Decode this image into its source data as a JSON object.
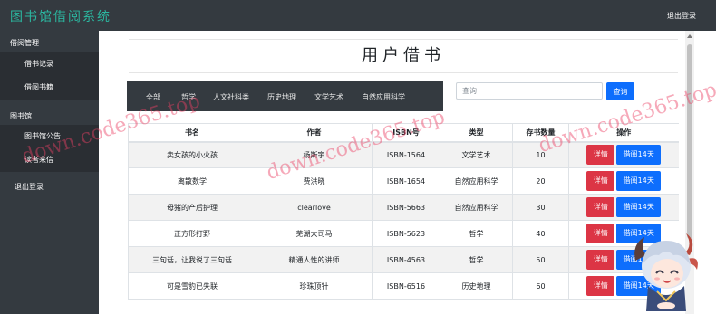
{
  "app": {
    "title": "图书馆借阅系统",
    "logout_label": "退出登录"
  },
  "sidebar": {
    "sections": [
      {
        "title": "借阅管理",
        "items": [
          "借书记录",
          "借阅书籍"
        ]
      },
      {
        "title": "图书馆",
        "items": [
          "图书馆公告",
          "读者来信"
        ]
      }
    ],
    "last_item": "退出登录"
  },
  "page": {
    "title": "用户借书"
  },
  "categories": [
    "全部",
    "哲学",
    "人文社科类",
    "历史地理",
    "文学艺术",
    "自然应用科学"
  ],
  "search": {
    "placeholder": "查询",
    "button_label": "查询"
  },
  "table": {
    "headers": [
      "书名",
      "作者",
      "ISBN号",
      "类型",
      "存书数量",
      "操作"
    ],
    "rows": [
      {
        "title": "卖女孩的小火孩",
        "author": "杨斯宇",
        "isbn": "ISBN-1564",
        "type": "文学艺术",
        "stock": "10"
      },
      {
        "title": "离散数学",
        "author": "费洪晓",
        "isbn": "ISBN-1654",
        "type": "自然应用科学",
        "stock": "20"
      },
      {
        "title": "母猪的产后护理",
        "author": "clearlove",
        "isbn": "ISBN-5663",
        "type": "自然应用科学",
        "stock": "30"
      },
      {
        "title": "正方形打野",
        "author": "芜湖大司马",
        "isbn": "ISBN-5623",
        "type": "哲学",
        "stock": "40"
      },
      {
        "title": "三句话，让我说了三句话",
        "author": "精通人性的讲师",
        "isbn": "ISBN-4563",
        "type": "哲学",
        "stock": "50"
      },
      {
        "title": "可是雪豹已失联",
        "author": "珍珠顶针",
        "isbn": "ISBN-6516",
        "type": "历史地理",
        "stock": "60"
      }
    ],
    "detail_label": "详情",
    "borrow_label": "借阅14天"
  },
  "watermark": {
    "text": "down.code365.top"
  },
  "colors": {
    "topbar": "#343a40",
    "brand": "#2bb7a0",
    "primary": "#0d6efd",
    "danger": "#dc3545",
    "watermark": "#eb4164"
  },
  "icons": {
    "mascot": "anime-mascot-icon"
  }
}
